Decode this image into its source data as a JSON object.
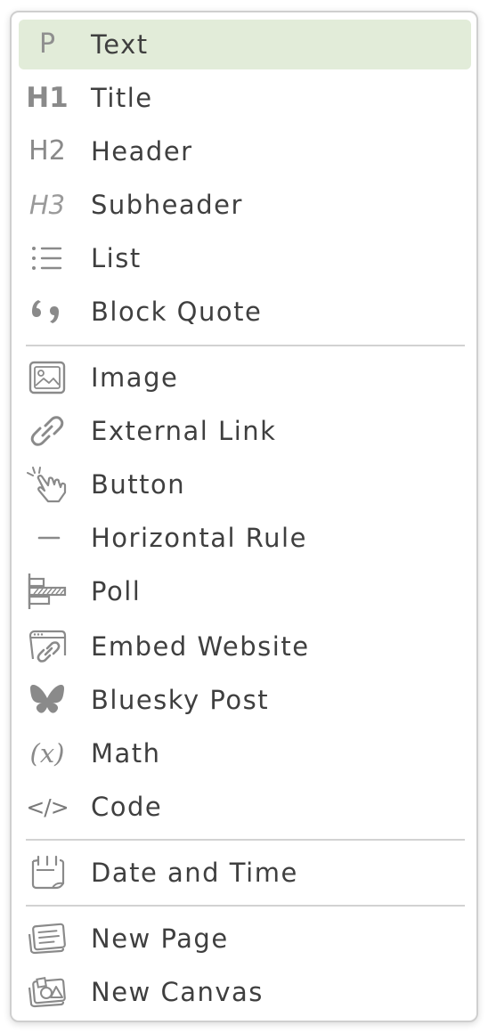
{
  "menu": {
    "items": [
      {
        "label": "Text",
        "icon": "paragraph-icon",
        "icon_text": "P"
      },
      {
        "label": "Title",
        "icon": "heading1-icon",
        "icon_text": "H1"
      },
      {
        "label": "Header",
        "icon": "heading2-icon",
        "icon_text": "H2"
      },
      {
        "label": "Subheader",
        "icon": "heading3-icon",
        "icon_text": "H3"
      },
      {
        "label": "List",
        "icon": "list-icon"
      },
      {
        "label": "Block Quote",
        "icon": "quote-icon"
      },
      {
        "label": "Image",
        "icon": "image-icon"
      },
      {
        "label": "External Link",
        "icon": "link-icon"
      },
      {
        "label": "Button",
        "icon": "button-click-icon"
      },
      {
        "label": "Horizontal Rule",
        "icon": "horizontal-rule-icon"
      },
      {
        "label": "Poll",
        "icon": "poll-icon"
      },
      {
        "label": "Embed Website",
        "icon": "embed-website-icon"
      },
      {
        "label": "Bluesky Post",
        "icon": "bluesky-butterfly-icon"
      },
      {
        "label": "Math",
        "icon": "math-icon",
        "icon_text": "(x)"
      },
      {
        "label": "Code",
        "icon": "code-icon",
        "icon_text": "</>"
      },
      {
        "label": "Date and Time",
        "icon": "calendar-icon"
      },
      {
        "label": "New Page",
        "icon": "new-page-icon"
      },
      {
        "label": "New Canvas",
        "icon": "new-canvas-icon"
      }
    ],
    "active_index": 0,
    "colors": {
      "active_background": "#e2ecd9",
      "icon": "#8a8a8a",
      "text": "#3f3f3f",
      "divider": "#d2d2d2"
    }
  }
}
